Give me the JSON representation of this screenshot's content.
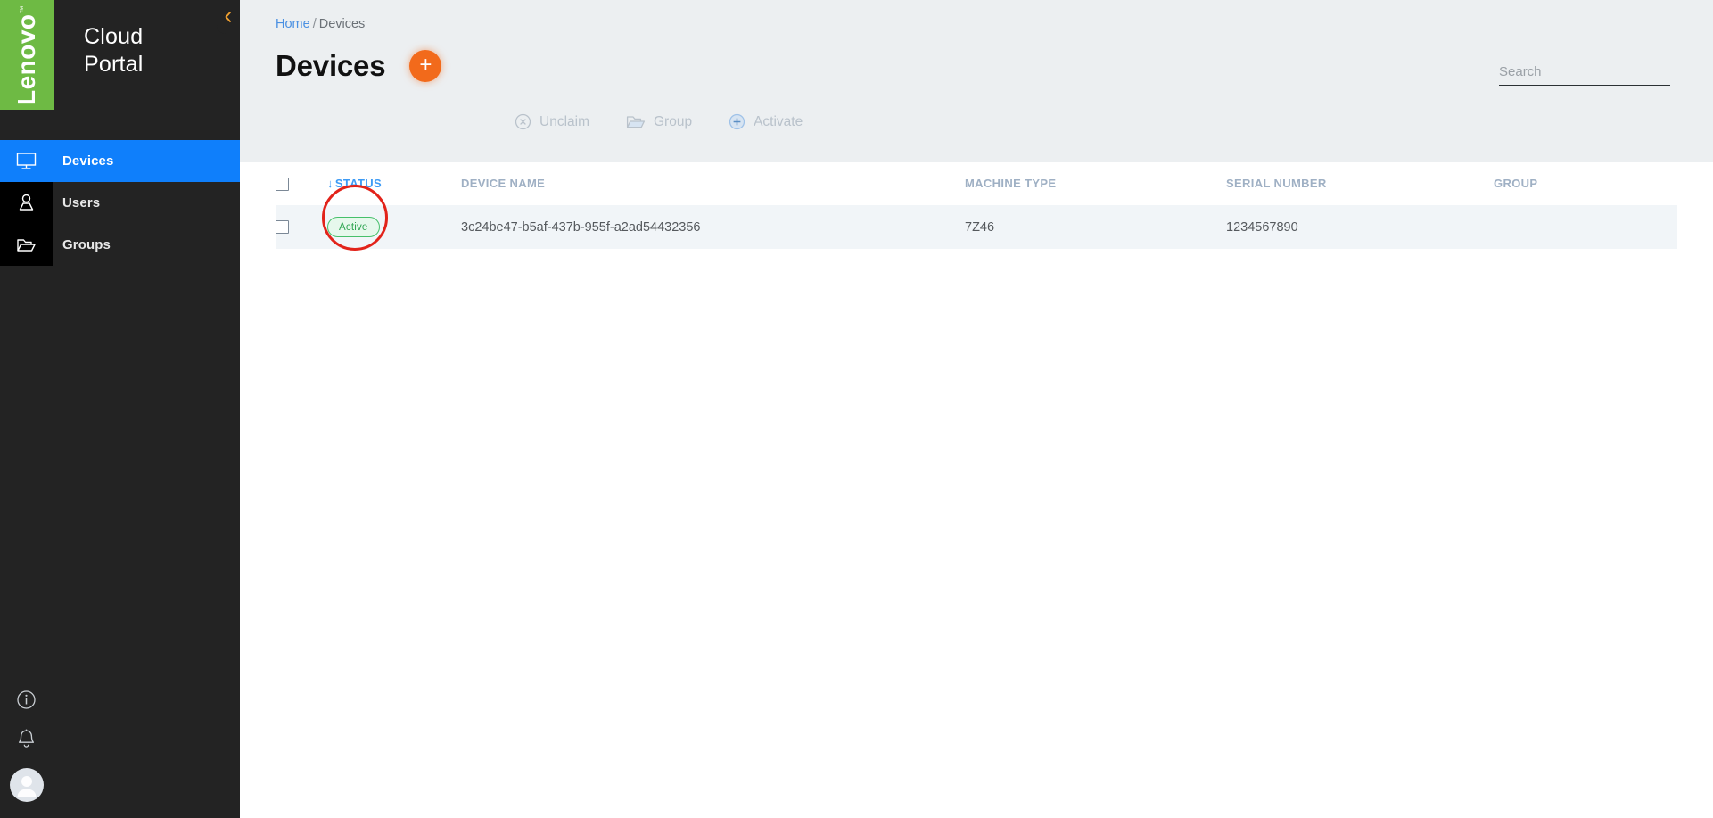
{
  "sidebar": {
    "logo": {
      "text": "Lenovo",
      "tm": "™",
      "brand_color": "#6eba44"
    },
    "portal_title": "Cloud\nPortal",
    "collapse_icon": "chevron-left-icon",
    "items": [
      {
        "label": "Devices",
        "icon": "monitor-icon",
        "active": true
      },
      {
        "label": "Users",
        "icon": "user-icon",
        "active": false
      },
      {
        "label": "Groups",
        "icon": "folder-open-icon",
        "active": false
      }
    ],
    "bottom_icons": [
      {
        "name": "info-icon"
      },
      {
        "name": "bell-icon"
      },
      {
        "name": "avatar"
      }
    ],
    "active_color": "#0f7ffb",
    "background": "#232323"
  },
  "breadcrumb": {
    "home": "Home",
    "separator": "/",
    "current": "Devices"
  },
  "header": {
    "title": "Devices",
    "add_button_label": "+",
    "add_button_color": "#f26a1b"
  },
  "search": {
    "placeholder": "Search",
    "value": "",
    "icon": "search-icon"
  },
  "toolbar": {
    "items": [
      {
        "label": "Unclaim",
        "icon": "circle-x-icon",
        "enabled": false
      },
      {
        "label": "Group",
        "icon": "folder-icon",
        "enabled": false
      },
      {
        "label": "Activate",
        "icon": "circle-plus-icon",
        "enabled": false
      }
    ]
  },
  "table": {
    "columns": [
      {
        "key": "checkbox",
        "label": ""
      },
      {
        "key": "status",
        "label": "STATUS",
        "sorted": true,
        "sort_direction": "desc",
        "sort_glyph": "↓"
      },
      {
        "key": "device_name",
        "label": "DEVICE NAME"
      },
      {
        "key": "machine_type",
        "label": "MACHINE TYPE"
      },
      {
        "key": "serial_number",
        "label": "SERIAL NUMBER"
      },
      {
        "key": "group",
        "label": "GROUP"
      }
    ],
    "rows": [
      {
        "selected": false,
        "status": "Active",
        "status_color": "#2fa551",
        "device_name": "3c24be47-b5af-437b-955f-a2ad54432356",
        "machine_type": "7Z46",
        "serial_number": "1234567890",
        "group": ""
      }
    ]
  },
  "annotation": {
    "type": "highlight-circle",
    "color": "#e2231a",
    "target": "status-badge"
  }
}
